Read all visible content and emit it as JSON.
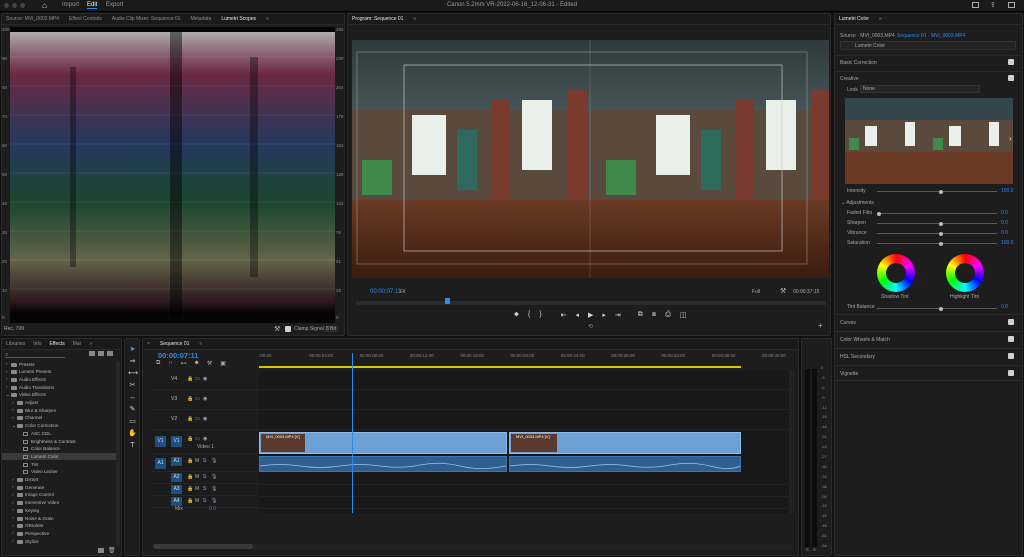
{
  "app": {
    "title": "Canon 5.2mm VR-2022-06-16_12-06-31 - Edited",
    "workspaces": [
      "Import",
      "Edit",
      "Export"
    ],
    "active_workspace": "Edit"
  },
  "source_panel": {
    "tabs": [
      "Source: MVI_0003.MP4",
      "Effect Controls",
      "Audio Clip Mixer: Sequence 01",
      "Metadata",
      "Lumetri Scopes"
    ],
    "left_ticks": [
      "100",
      "90",
      "80",
      "70",
      "60",
      "50",
      "40",
      "30",
      "20",
      "10",
      "0"
    ],
    "right_ticks": [
      "255",
      "230",
      "204",
      "178",
      "153",
      "128",
      "102",
      "76",
      "51",
      "26",
      "0"
    ],
    "footer_left": "Rec. 709",
    "clamp_label": "Clamp Signal",
    "bit_label": "8 Bit"
  },
  "program": {
    "title": "Program: Sequence 01",
    "timecode": "00:00:07:11",
    "fit": "Fit",
    "quality": "Full",
    "duration": "00:00:37:15"
  },
  "lumetri": {
    "title": "Lumetri Color",
    "source": "Source · MVI_0003.MP4",
    "sequence_link": "Sequence 01 · MVI_0003.MP4",
    "effect": "Lumetri Color",
    "sections": [
      "Basic Correction",
      "Creative"
    ],
    "look_label": "Look",
    "look_value": "None",
    "intensity_label": "Intensity",
    "intensity_value": "100.0",
    "adjustments_label": "Adjustments",
    "sliders": [
      {
        "label": "Faded Film",
        "value": "0.0"
      },
      {
        "label": "Sharpen",
        "value": "0.0"
      },
      {
        "label": "Vibrance",
        "value": "0.0"
      },
      {
        "label": "Saturation",
        "value": "100.0"
      }
    ],
    "shadow_tint": "Shadow Tint",
    "highlight_tint": "Highlight Tint",
    "tint_balance_label": "Tint Balance",
    "tint_balance_value": "0.0",
    "lower_sections": [
      "Curves",
      "Color Wheels & Match",
      "HSL Secondary",
      "Vignette"
    ]
  },
  "project": {
    "tabs": [
      "Libraries",
      "Info",
      "Effects",
      "Mar"
    ],
    "tree": [
      {
        "label": "Presets",
        "level": 0
      },
      {
        "label": "Lumetri Presets",
        "level": 0
      },
      {
        "label": "Audio Effects",
        "level": 0
      },
      {
        "label": "Audio Transitions",
        "level": 0
      },
      {
        "label": "Video Effects",
        "level": 0
      },
      {
        "label": "Adjust",
        "level": 1
      },
      {
        "label": "Blur & Sharpen",
        "level": 1
      },
      {
        "label": "Channel",
        "level": 1
      },
      {
        "label": "Color Correction",
        "level": 1
      },
      {
        "label": "ASC CDL",
        "level": 2
      },
      {
        "label": "Brightness & Contrast",
        "level": 2
      },
      {
        "label": "Color Balance",
        "level": 2
      },
      {
        "label": "Lumetri Color",
        "level": 2
      },
      {
        "label": "Tint",
        "level": 2
      },
      {
        "label": "Video Limiter",
        "level": 2
      },
      {
        "label": "Distort",
        "level": 1
      },
      {
        "label": "Generate",
        "level": 1
      },
      {
        "label": "Image Control",
        "level": 1
      },
      {
        "label": "Immersive Video",
        "level": 1
      },
      {
        "label": "Keying",
        "level": 1
      },
      {
        "label": "Noise & Grain",
        "level": 1
      },
      {
        "label": "Obsolete",
        "level": 1
      },
      {
        "label": "Perspective",
        "level": 1
      },
      {
        "label": "Stylize",
        "level": 1
      }
    ],
    "selected": "Lumetri Color"
  },
  "timeline": {
    "title": "Sequence 01",
    "timecode": "00:00:07:11",
    "ruler": [
      ":00:00",
      "00:00:04:00",
      "00:00:08:00",
      "00:00:12:00",
      "00:00:16:00",
      "00:00:20:00",
      "00:00:24:00",
      "00:00:28:00",
      "00:00:32:00",
      "00:00:36:00",
      "00:00:40:00"
    ],
    "video_tracks": [
      "V4",
      "V3",
      "V2",
      "V1"
    ],
    "v1_name": "Video 1",
    "audio_tracks": [
      "A1",
      "A2",
      "A3",
      "A4"
    ],
    "mix_label": "Mix",
    "mix_value": "0.0",
    "clip1": "MVI_0003.MP4 [V]",
    "clip2": "MVI_0003.MP4 [V]",
    "meter_ticks": [
      "0",
      "-3",
      "-6",
      "-9",
      "-12",
      "-15",
      "-18",
      "-21",
      "-24",
      "-27",
      "-30",
      "-33",
      "-36",
      "-39",
      "-42",
      "-45",
      "-48",
      "-51",
      "-54"
    ],
    "meter_foot": [
      "S",
      "S"
    ]
  }
}
